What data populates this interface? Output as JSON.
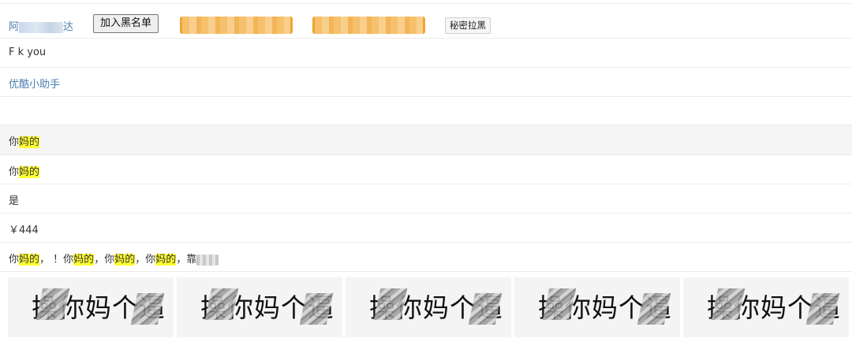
{
  "header": {
    "user_name_start": "阿",
    "user_name_end": "达",
    "blacklist_button": "加入黑名单",
    "secret_pull_black_button": "秘密拉黑"
  },
  "rows": [
    {
      "text": "F  k you"
    },
    {
      "text": "优酷小助手"
    },
    {
      "text": ""
    },
    {
      "prefix": "你",
      "highlight": "妈的"
    },
    {
      "prefix": "你",
      "highlight": "妈的"
    },
    {
      "text": "是"
    },
    {
      "text": "￥444"
    }
  ],
  "long_comment": {
    "segments": [
      {
        "t": "你"
      },
      {
        "h": "妈的"
      },
      {
        "t": "，  ！你"
      },
      {
        "h": "妈的"
      },
      {
        "t": "，你"
      },
      {
        "h": "妈的"
      },
      {
        "t": "，你"
      },
      {
        "h": "妈的"
      },
      {
        "t": "，靠"
      }
    ]
  },
  "stickers": [
    {
      "text": "操你妈个逼"
    },
    {
      "text": "操你妈个逼"
    },
    {
      "text": "操你妈个逼"
    },
    {
      "text": "操你妈个逼"
    },
    {
      "text": "操你妈个逼"
    }
  ],
  "colors": {
    "link": "#4a7eb0",
    "highlight": "#ffff33",
    "accent_orange": "#f0a42e",
    "hover_row": "#f5f5f5"
  }
}
